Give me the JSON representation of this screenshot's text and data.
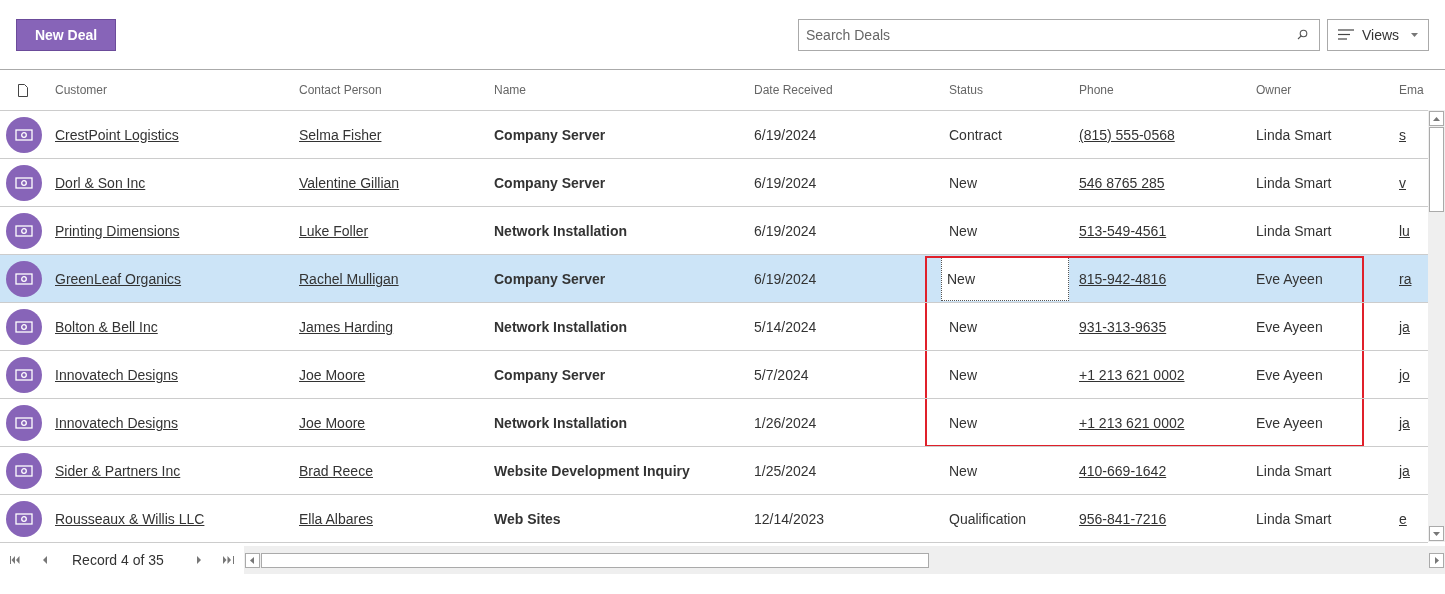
{
  "toolbar": {
    "new_button": "New Deal",
    "search": {
      "placeholder": "Search Deals"
    },
    "views_button": "Views"
  },
  "table": {
    "columns": [
      "Customer",
      "Contact Person",
      "Name",
      "Date Received",
      "Status",
      "Phone",
      "Owner",
      "Ema"
    ],
    "rows": [
      {
        "customer": "CrestPoint Logistics",
        "contact": "Selma Fisher",
        "name": "Company Server",
        "date": "6/19/2024",
        "status": "Contract",
        "phone": "(815) 555-0568",
        "owner": "Linda Smart",
        "column_8": "s",
        "selected": false,
        "highlighted": false
      },
      {
        "customer": "Dorl & Son Inc",
        "contact": "Valentine Gillian",
        "name": "Company Server",
        "date": "6/19/2024",
        "status": "New",
        "phone": "546 8765 285",
        "owner": "Linda Smart",
        "column_8": "v",
        "selected": false,
        "highlighted": false
      },
      {
        "customer": "Printing Dimensions",
        "contact": "Luke Foller",
        "name": "Network Installation",
        "date": "6/19/2024",
        "status": "New",
        "phone": "513-549-4561",
        "owner": "Linda Smart",
        "column_8": "lu",
        "selected": false,
        "highlighted": false
      },
      {
        "customer": "GreenLeaf Organics",
        "contact": "Rachel Mulligan",
        "name": "Company Server",
        "date": "6/19/2024",
        "status": "New",
        "phone": "815-942-4816",
        "owner": "Eve Ayeen",
        "column_8": "ra",
        "selected": true,
        "highlighted": true
      },
      {
        "customer": "Bolton & Bell Inc",
        "contact": "James Harding",
        "name": "Network Installation",
        "date": "5/14/2024",
        "status": "New",
        "phone": "931-313-9635",
        "owner": "Eve Ayeen",
        "column_8": "ja",
        "selected": false,
        "highlighted": true
      },
      {
        "customer": "Innovatech Designs",
        "contact": "Joe Moore",
        "name": "Company Server",
        "date": "5/7/2024",
        "status": "New",
        "phone": "+1 213 621 0002",
        "owner": "Eve Ayeen",
        "column_8": "jo",
        "selected": false,
        "highlighted": true
      },
      {
        "customer": "Innovatech Designs",
        "contact": "Joe Moore",
        "name": "Network Installation",
        "date": "1/26/2024",
        "status": "New",
        "phone": "+1 213 621 0002",
        "owner": "Eve Ayeen",
        "column_8": "ja",
        "selected": false,
        "highlighted": true
      },
      {
        "customer": "Sider & Partners Inc",
        "contact": "Brad Reece",
        "name": "Website Development Inquiry",
        "date": "1/25/2024",
        "status": "New",
        "phone": "410-669-1642",
        "owner": "Linda Smart",
        "column_8": "ja",
        "selected": false,
        "highlighted": false
      },
      {
        "customer": "Rousseaux & Willis LLC",
        "contact": "Ella Albares",
        "name": "Web Sites",
        "date": "12/14/2023",
        "status": "Qualification",
        "phone": "956-841-7216",
        "owner": "Linda Smart",
        "column_8": "e",
        "selected": false,
        "highlighted": false
      }
    ]
  },
  "pager": {
    "record": "Record 4 of 35"
  }
}
